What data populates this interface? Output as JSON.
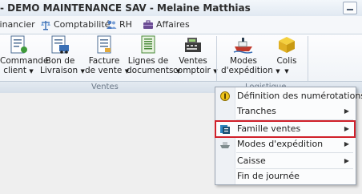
{
  "window": {
    "title": "- DEMO MAINTENANCE SAV - Melaine Matthias"
  },
  "module_tabs": [
    {
      "label": "Financier",
      "icon": "finance-icon"
    },
    {
      "label": "Comptabilité",
      "icon": "accounting-scale-icon"
    },
    {
      "label": "RH",
      "icon": "hr-users-icon"
    },
    {
      "label": "Affaires",
      "icon": "business-briefcase-icon"
    }
  ],
  "ribbon": {
    "buttons": [
      {
        "line1": "Commande",
        "line2": "client",
        "icon": "order-icon"
      },
      {
        "line1": "Bon de",
        "line2": "Livraison",
        "icon": "delivery-note-icon"
      },
      {
        "line1": "Facture",
        "line2": "de vente",
        "icon": "invoice-icon"
      },
      {
        "line1": "Lignes de",
        "line2": "documents",
        "icon": "document-lines-icon"
      },
      {
        "line1": "Ventes",
        "line2": "comptoir",
        "icon": "cash-register-icon"
      },
      {
        "line1": "Modes",
        "line2": "d'expédition",
        "icon": "ship-icon"
      },
      {
        "line1": "Colis",
        "line2": "",
        "icon": "package-icon"
      }
    ],
    "groups": {
      "ventes": "Ventes",
      "logistique": "Logistique"
    }
  },
  "menu": {
    "items": [
      {
        "label": "Définition des numérotations",
        "icon": "numbering-icon",
        "submenu": false
      },
      {
        "label": "Tranches",
        "icon": "",
        "submenu": true
      },
      {
        "label": "Famille ventes",
        "icon": "sales-family-icon",
        "submenu": true,
        "highlighted": true
      },
      {
        "label": "Modes d'expédition",
        "icon": "shipping-mode-icon",
        "submenu": true
      },
      {
        "label": "Caisse",
        "icon": "",
        "submenu": true
      },
      {
        "label": "Fin de journée",
        "icon": "",
        "submenu": false
      }
    ],
    "colors": {
      "highlight_border": "#d0202a"
    }
  }
}
